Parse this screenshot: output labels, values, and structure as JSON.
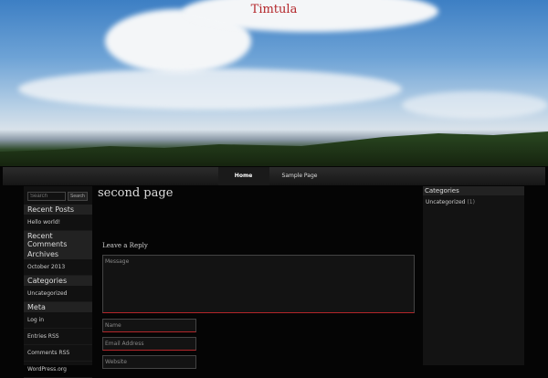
{
  "site": {
    "title": "Timtula"
  },
  "nav": {
    "items": [
      {
        "label": "Home"
      },
      {
        "label": "Sample Page"
      }
    ]
  },
  "left_sidebar": {
    "search_placeholder": "Search",
    "search_button": "Search",
    "recent_posts_title": "Recent Posts",
    "recent_posts": [
      "Hello world!"
    ],
    "recent_comments_title": "Recent Comments",
    "archives_title": "Archives",
    "archives": [
      "October 2013"
    ],
    "categories_title": "Categories",
    "categories": [
      "Uncategorized"
    ],
    "meta_title": "Meta",
    "meta": [
      "Log in",
      "Entries RSS",
      "Comments RSS",
      "WordPress.org"
    ]
  },
  "main": {
    "page_title": "second page",
    "reply_title": "Leave a Reply",
    "message_placeholder": "Message",
    "name_placeholder": "Name",
    "email_placeholder": "Email Address",
    "website_placeholder": "Website"
  },
  "right_sidebar": {
    "title": "Categories",
    "item": "Uncategorized",
    "count": "(1)"
  }
}
